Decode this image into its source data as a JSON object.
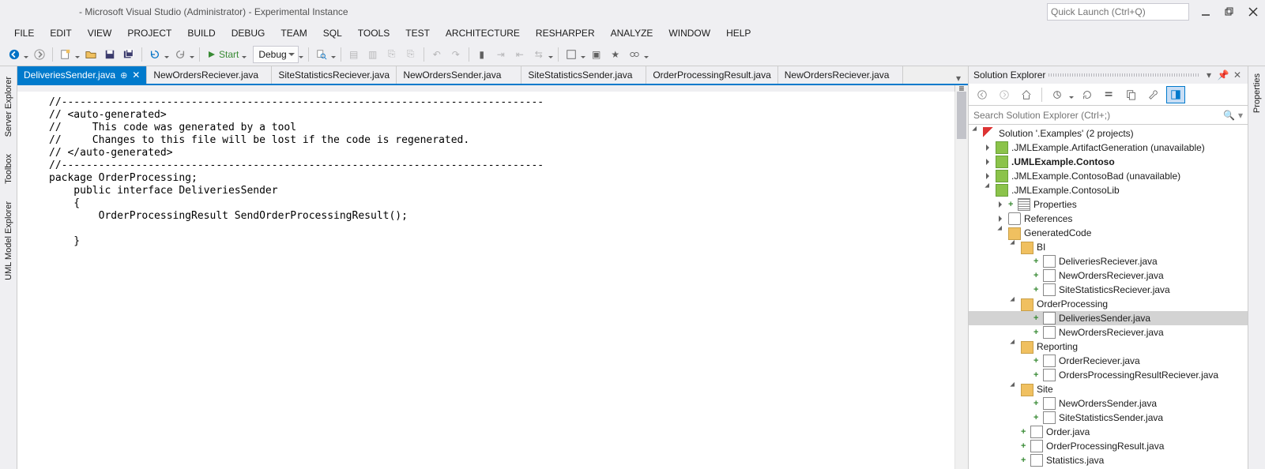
{
  "title": " - Microsoft Visual Studio (Administrator) - Experimental Instance",
  "quick_launch_placeholder": "Quick Launch (Ctrl+Q)",
  "menus": [
    "FILE",
    "EDIT",
    "VIEW",
    "PROJECT",
    "BUILD",
    "DEBUG",
    "TEAM",
    "SQL",
    "TOOLS",
    "TEST",
    "ARCHITECTURE",
    "RESHARPER",
    "ANALYZE",
    "WINDOW",
    "HELP"
  ],
  "toolbar": {
    "start_label": "Start",
    "config_label": "Debug"
  },
  "left_tabs": [
    "Server Explorer",
    "Toolbox",
    "UML Model Explorer"
  ],
  "right_tabs": [
    "Properties"
  ],
  "doc_tabs": [
    {
      "label": "DeliveriesSender.java",
      "active": true,
      "pinned": true,
      "close": true
    },
    {
      "label": "NewOrdersReciever.java"
    },
    {
      "label": "SiteStatisticsReciever.java"
    },
    {
      "label": "NewOrdersSender.java"
    },
    {
      "label": "SiteStatisticsSender.java"
    },
    {
      "label": "OrderProcessingResult.java"
    },
    {
      "label": "NewOrdersReciever.java"
    }
  ],
  "code_text": "//------------------------------------------------------------------------------\n// <auto-generated>\n//     This code was generated by a tool\n//     Changes to this file will be lost if the code is regenerated.\n// </auto-generated>\n//------------------------------------------------------------------------------\npackage OrderProcessing;\n    public interface DeliveriesSender\n    {\n        OrderProcessingResult SendOrderProcessingResult();\n\n    }\n",
  "solex": {
    "title": "Solution Explorer",
    "search_placeholder": "Search Solution Explorer (Ctrl+;)",
    "tree": [
      {
        "d": 0,
        "tw": "exp",
        "ico": "sln",
        "label": "Solution         '.Examples' (2 projects)"
      },
      {
        "d": 1,
        "tw": "col",
        "ico": "csproj",
        "label": ".JMLExample.ArtifactGeneration (unavailable)"
      },
      {
        "d": 1,
        "tw": "col",
        "ico": "csproj",
        "label": ".UMLExample.Contoso",
        "bold": true
      },
      {
        "d": 1,
        "tw": "col",
        "ico": "csproj",
        "label": ".JMLExample.ContosoBad (unavailable)"
      },
      {
        "d": 1,
        "tw": "exp",
        "ico": "csproj",
        "label": ".JMLExample.ContosoLib"
      },
      {
        "d": 2,
        "tw": "col",
        "plus": true,
        "ico": "prop",
        "label": "Properties"
      },
      {
        "d": 2,
        "tw": "col",
        "ico": "ref",
        "label": "References"
      },
      {
        "d": 2,
        "tw": "exp",
        "ico": "folder",
        "label": "GeneratedCode"
      },
      {
        "d": 3,
        "tw": "exp",
        "ico": "folder",
        "label": "BI"
      },
      {
        "d": 4,
        "plus": true,
        "ico": "file",
        "label": "DeliveriesReciever.java"
      },
      {
        "d": 4,
        "plus": true,
        "ico": "file",
        "label": "NewOrdersReciever.java"
      },
      {
        "d": 4,
        "plus": true,
        "ico": "file",
        "label": "SiteStatisticsReciever.java"
      },
      {
        "d": 3,
        "tw": "exp",
        "ico": "folder",
        "label": "OrderProcessing"
      },
      {
        "d": 4,
        "plus": true,
        "ico": "file",
        "label": "DeliveriesSender.java",
        "selected": true
      },
      {
        "d": 4,
        "plus": true,
        "ico": "file",
        "label": "NewOrdersReciever.java"
      },
      {
        "d": 3,
        "tw": "exp",
        "ico": "folder",
        "label": "Reporting"
      },
      {
        "d": 4,
        "plus": true,
        "ico": "file",
        "label": "OrderReciever.java"
      },
      {
        "d": 4,
        "plus": true,
        "ico": "file",
        "label": "OrdersProcessingResultReciever.java"
      },
      {
        "d": 3,
        "tw": "exp",
        "ico": "folder",
        "label": "Site"
      },
      {
        "d": 4,
        "plus": true,
        "ico": "file",
        "label": "NewOrdersSender.java"
      },
      {
        "d": 4,
        "plus": true,
        "ico": "file",
        "label": "SiteStatisticsSender.java"
      },
      {
        "d": 3,
        "plus": true,
        "ico": "file",
        "label": "Order.java"
      },
      {
        "d": 3,
        "plus": true,
        "ico": "file",
        "label": "OrderProcessingResult.java"
      },
      {
        "d": 3,
        "plus": true,
        "ico": "file",
        "label": "Statistics.java"
      }
    ]
  }
}
